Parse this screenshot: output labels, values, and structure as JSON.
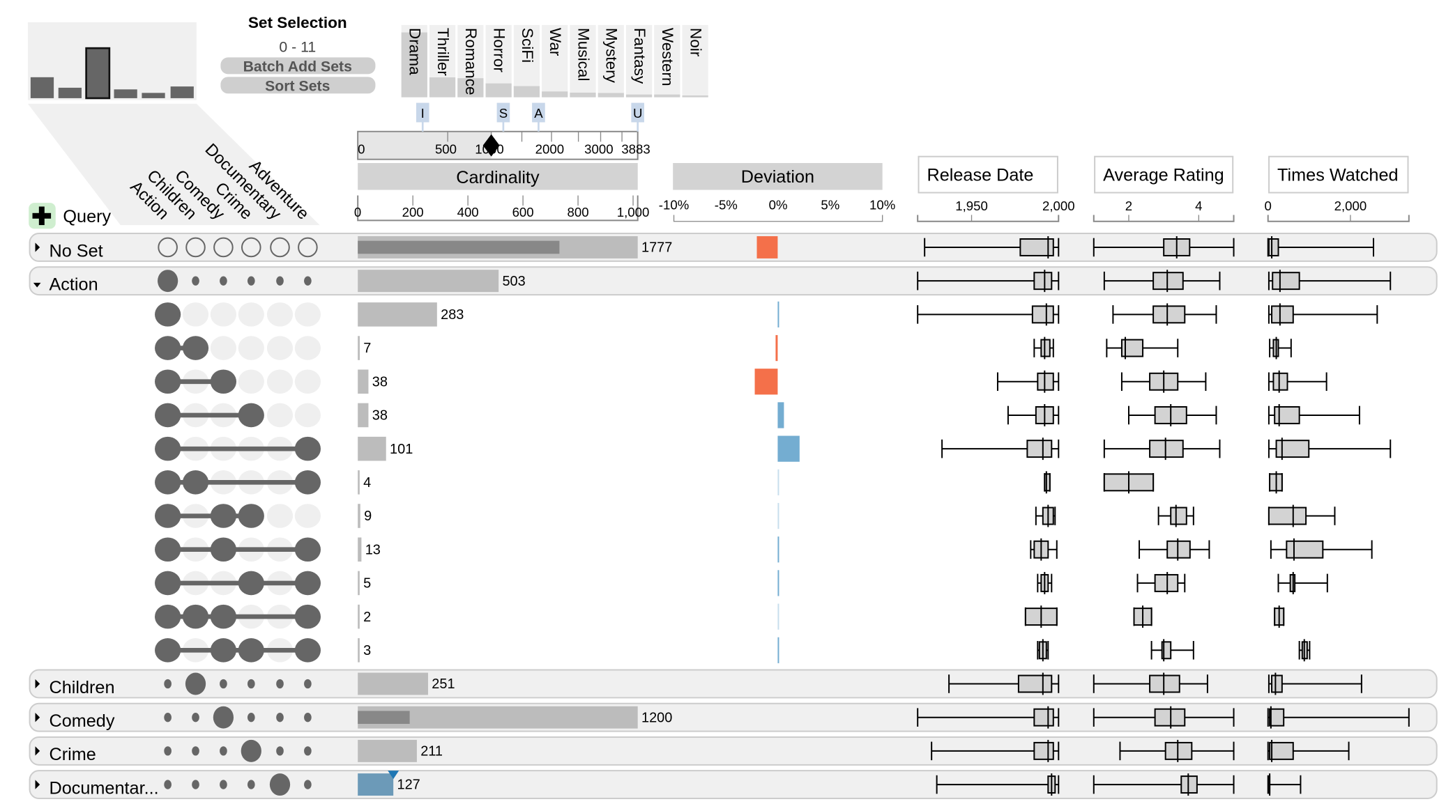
{
  "set_selection": {
    "title": "Set Selection",
    "range": "0 - 11",
    "batch_add_label": "Batch Add Sets",
    "sort_label": "Sort Sets",
    "selected_sets": [
      {
        "name": "Action",
        "size": 503
      },
      {
        "name": "Children",
        "size": 251
      },
      {
        "name": "Comedy",
        "size": 1200,
        "highlighted": true
      },
      {
        "name": "Crime",
        "size": 211
      },
      {
        "name": "Documentary",
        "size": 127
      },
      {
        "name": "Adventure",
        "size": 281
      }
    ],
    "unselected_sets": [
      {
        "name": "Drama",
        "size": 1603
      },
      {
        "name": "Thriller",
        "size": 492
      },
      {
        "name": "Romance",
        "size": 471
      },
      {
        "name": "Horror",
        "size": 343
      },
      {
        "name": "SciFi",
        "size": 276
      },
      {
        "name": "War",
        "size": 143
      },
      {
        "name": "Musical",
        "size": 114
      },
      {
        "name": "Mystery",
        "size": 106
      },
      {
        "name": "Fantasy",
        "size": 68
      },
      {
        "name": "Western",
        "size": 68
      },
      {
        "name": "Noir",
        "size": 44
      }
    ]
  },
  "query": {
    "label": "Query"
  },
  "slider": {
    "ticks": [
      "0",
      "500",
      "1000",
      "2000",
      "3000",
      "3883"
    ],
    "max": 3883,
    "value": 1000,
    "markers": [
      {
        "label": "I",
        "value": 300
      },
      {
        "label": "S",
        "value": 1100
      },
      {
        "label": "A",
        "value": 1700
      },
      {
        "label": "U",
        "value": 3883
      }
    ]
  },
  "cardinality": {
    "header": "Cardinality",
    "ticks": [
      "0",
      "200",
      "400",
      "600",
      "800",
      "1,000"
    ],
    "max": 1000
  },
  "deviation": {
    "header": "Deviation",
    "ticks": [
      "-10%",
      "-5%",
      "0%",
      "5%",
      "10%"
    ],
    "positive_color": "#74add1",
    "negative_color": "#f4704a"
  },
  "attributes": [
    {
      "header": "Release Date",
      "ticks": [
        "1,950",
        "2,000"
      ],
      "tick_values": [
        1950,
        2000
      ],
      "domain": [
        1919,
        2000
      ]
    },
    {
      "header": "Average Rating",
      "ticks": [
        "2",
        "4"
      ],
      "tick_values": [
        2,
        4
      ],
      "domain": [
        1,
        5
      ]
    },
    {
      "header": "Times Watched",
      "ticks": [
        "0",
        "2,000"
      ],
      "tick_values": [
        0,
        2000
      ],
      "domain": [
        0,
        3420
      ]
    }
  ],
  "rows": [
    {
      "type": "group",
      "label": "No Set",
      "expanded": false,
      "members": [],
      "card": 1777,
      "dev": -2.0,
      "box": [
        [
          1923,
          1978,
          1994,
          1997,
          2000
        ],
        [
          1.0,
          3.0,
          3.37,
          3.74,
          5.0
        ],
        [
          0,
          20,
          90,
          250,
          2560
        ]
      ]
    },
    {
      "type": "group",
      "label": "Action",
      "expanded": true,
      "members": [
        0
      ],
      "card": 503,
      "dev": null,
      "box": [
        [
          1919,
          1986,
          1992,
          1996,
          2000
        ],
        [
          1.3,
          2.7,
          3.1,
          3.55,
          4.6
        ],
        [
          20,
          110,
          290,
          760,
          2970
        ]
      ]
    },
    {
      "type": "subset",
      "members": [
        0
      ],
      "card": 283,
      "dev": 0.1,
      "box": [
        [
          1919,
          1985,
          1993,
          1997,
          2000
        ],
        [
          1.55,
          2.7,
          3.1,
          3.6,
          4.5
        ],
        [
          20,
          90,
          290,
          610,
          2650
        ]
      ]
    },
    {
      "type": "subset",
      "members": [
        0,
        1
      ],
      "card": 7,
      "dev": -0.2,
      "box": [
        [
          1986,
          1990,
          1992,
          1995,
          1997
        ],
        [
          1.37,
          1.8,
          1.9,
          2.4,
          3.4
        ],
        [
          40,
          130,
          200,
          250,
          560
        ]
      ]
    },
    {
      "type": "subset",
      "members": [
        0,
        2
      ],
      "card": 38,
      "dev": -2.2,
      "box": [
        [
          1965,
          1988,
          1992,
          1997,
          2000
        ],
        [
          1.8,
          2.6,
          3.0,
          3.4,
          4.2
        ],
        [
          20,
          130,
          270,
          470,
          1420
        ]
      ]
    },
    {
      "type": "subset",
      "members": [
        0,
        3
      ],
      "card": 38,
      "dev": 0.6,
      "box": [
        [
          1971,
          1987,
          1992,
          1997,
          2000
        ],
        [
          2.0,
          2.75,
          3.2,
          3.65,
          4.5
        ],
        [
          20,
          160,
          270,
          760,
          2220
        ]
      ]
    },
    {
      "type": "subset",
      "members": [
        0,
        5
      ],
      "card": 101,
      "dev": 2.1,
      "box": [
        [
          1933,
          1982,
          1991,
          1996,
          2000
        ],
        [
          1.3,
          2.6,
          3.05,
          3.55,
          4.6
        ],
        [
          20,
          200,
          340,
          990,
          2970
        ]
      ]
    },
    {
      "type": "subset",
      "members": [
        0,
        1,
        5
      ],
      "card": 4,
      "dev": 0.0,
      "box": [
        [
          1992,
          1992,
          1993,
          1995,
          1995
        ],
        [
          1.3,
          1.3,
          2.0,
          2.7,
          2.7
        ],
        [
          40,
          40,
          200,
          340,
          340
        ]
      ]
    },
    {
      "type": "subset",
      "members": [
        0,
        2,
        3
      ],
      "card": 9,
      "dev": 0.0,
      "box": [
        [
          1987,
          1991,
          1994,
          1997,
          1998
        ],
        [
          2.85,
          3.2,
          3.35,
          3.65,
          3.85
        ],
        [
          20,
          20,
          610,
          920,
          1620
        ]
      ]
    },
    {
      "type": "subset",
      "members": [
        0,
        2,
        5
      ],
      "card": 13,
      "dev": 0.05,
      "box": [
        [
          1984,
          1986,
          1990,
          1994,
          1999
        ],
        [
          2.3,
          3.1,
          3.4,
          3.75,
          4.3
        ],
        [
          70,
          450,
          630,
          1330,
          2520
        ]
      ]
    },
    {
      "type": "subset",
      "members": [
        0,
        3,
        5
      ],
      "card": 5,
      "dev": 0.05,
      "box": [
        [
          1988,
          1990,
          1992,
          1994,
          1996
        ],
        [
          2.25,
          2.75,
          3.1,
          3.4,
          3.6
        ],
        [
          250,
          540,
          610,
          650,
          1440
        ]
      ]
    },
    {
      "type": "subset",
      "members": [
        0,
        1,
        2,
        5
      ],
      "card": 2,
      "dev": 0.0,
      "box": [
        [
          1981,
          1981,
          1990,
          1999,
          1999
        ],
        [
          2.15,
          2.15,
          2.4,
          2.65,
          2.65
        ],
        [
          160,
          160,
          270,
          380,
          380
        ]
      ]
    },
    {
      "type": "subset",
      "members": [
        0,
        2,
        3,
        5
      ],
      "card": 3,
      "dev": 0.05,
      "box": [
        [
          1988,
          1989,
          1991,
          1993,
          1994
        ],
        [
          2.65,
          2.95,
          3.0,
          3.2,
          3.85
        ],
        [
          760,
          830,
          880,
          950,
          1010
        ]
      ]
    },
    {
      "type": "group",
      "label": "Children",
      "expanded": false,
      "members": [
        1
      ],
      "card": 251,
      "dev": null,
      "box": [
        [
          1937,
          1977,
          1991,
          1996,
          2000
        ],
        [
          1.0,
          2.6,
          3.0,
          3.45,
          4.25
        ],
        [
          20,
          90,
          180,
          340,
          2270
        ]
      ]
    },
    {
      "type": "group",
      "label": "Comedy",
      "expanded": false,
      "members": [
        2
      ],
      "card": 1200,
      "dev": null,
      "box": [
        [
          1919,
          1986,
          1994,
          1997,
          2000
        ],
        [
          1.0,
          2.75,
          3.2,
          3.6,
          5.0
        ],
        [
          0,
          40,
          70,
          380,
          3420
        ]
      ]
    },
    {
      "type": "group",
      "label": "Crime",
      "expanded": false,
      "members": [
        3
      ],
      "card": 211,
      "dev": null,
      "box": [
        [
          1927,
          1986,
          1994,
          1997,
          2000
        ],
        [
          1.75,
          3.05,
          3.4,
          3.8,
          5.0
        ],
        [
          0,
          40,
          90,
          610,
          1960
        ]
      ]
    },
    {
      "type": "group",
      "label": "Documentar...",
      "expanded": false,
      "members": [
        4
      ],
      "card": 127,
      "dev": null,
      "selected": true,
      "box": [
        [
          1930,
          1994,
          1996,
          1998,
          2000
        ],
        [
          1.0,
          3.5,
          3.7,
          3.95,
          5.0
        ],
        [
          0,
          20,
          40,
          40,
          790
        ]
      ]
    }
  ]
}
